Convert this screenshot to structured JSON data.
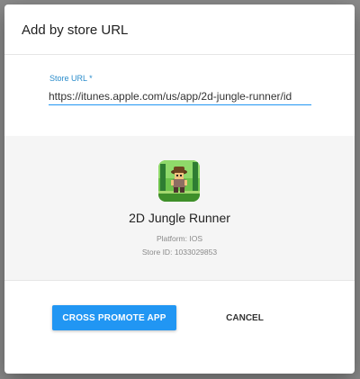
{
  "dialog": {
    "title": "Add by store URL"
  },
  "form": {
    "store_url_label": "Store URL *",
    "store_url_value": "https://itunes.apple.com/us/app/2d-jungle-runner/id"
  },
  "app": {
    "icon": "app-icon-jungle-runner",
    "name": "2D Jungle Runner",
    "platform_label": "Platform:",
    "platform_value": "IOS",
    "store_id_label": "Store ID:",
    "store_id_value": "1033029853"
  },
  "actions": {
    "primary_label": "CROSS PROMOTE APP",
    "cancel_label": "CANCEL"
  },
  "colors": {
    "accent": "#2196f3",
    "overlay": "#8a8a8a"
  }
}
